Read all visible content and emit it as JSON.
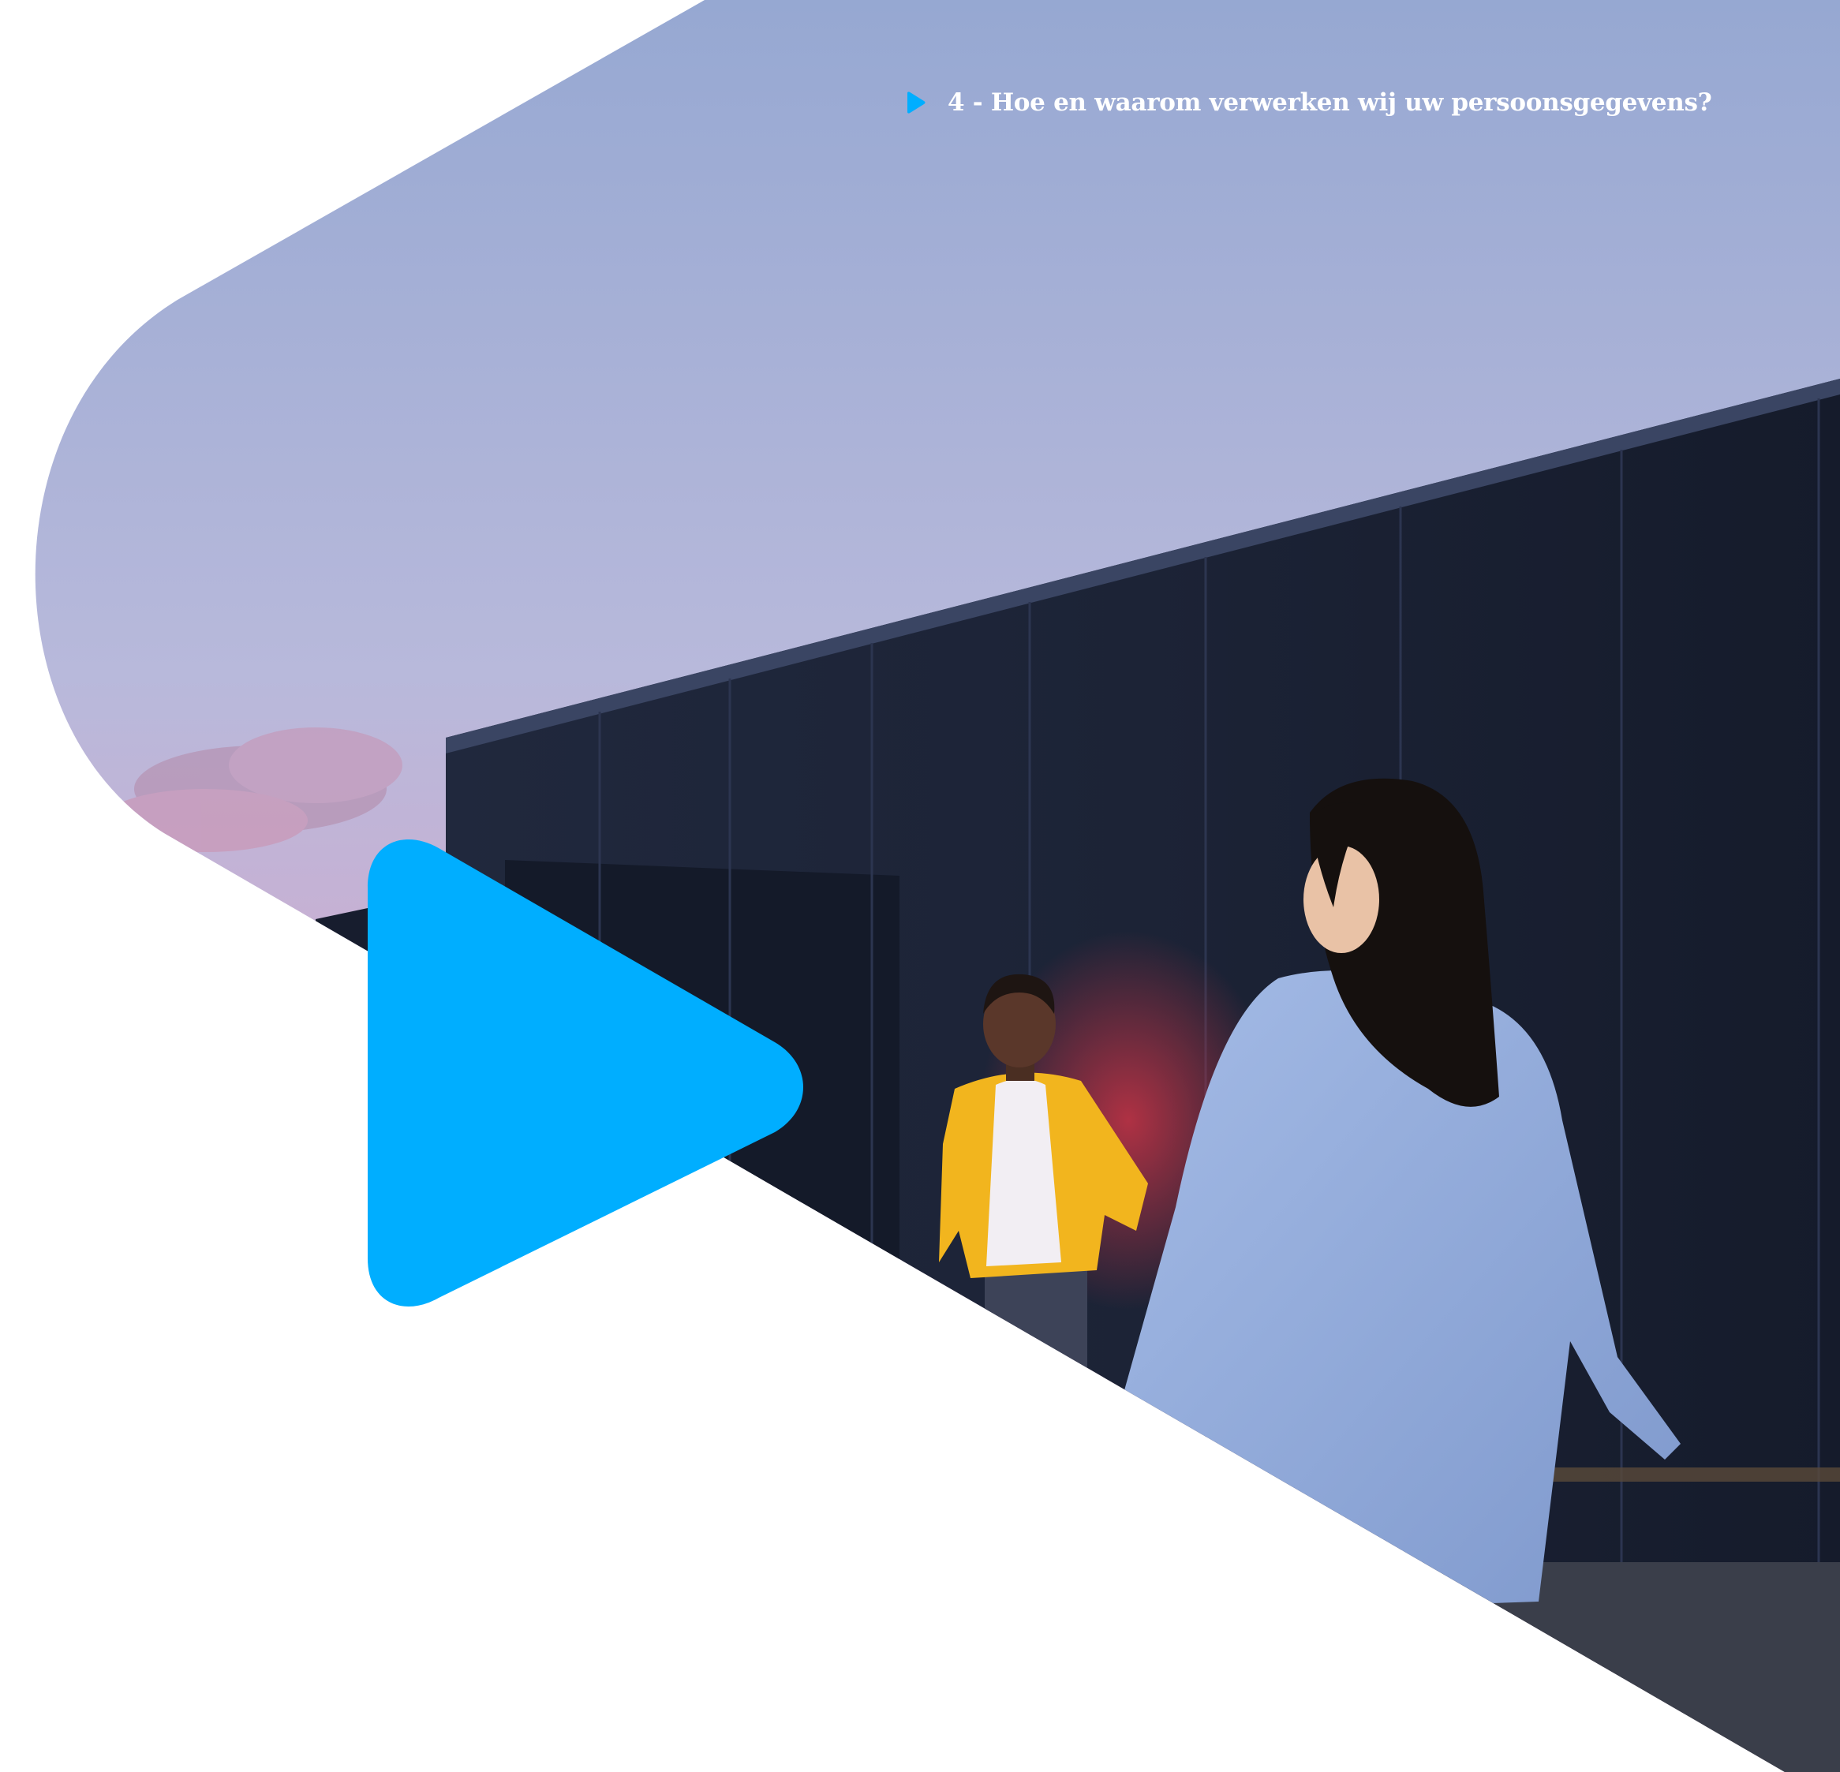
{
  "page": {
    "section_heading": "4 - Hoe en waarom verwerken wij uw persoonsgegevens?"
  },
  "icons": {
    "heading_marker": "play-triangle-icon",
    "large_decoration": "play-triangle-icon"
  },
  "colors": {
    "accent": "#00AEFF",
    "heading_text": "#ffffff",
    "page_background": "#ffffff",
    "sky_top": "#98A9D3",
    "sky_bottom": "#D4A8C8",
    "wall": "#1B2236",
    "jacket_yellow": "#F2B51E",
    "coat_blue": "#92ADDD"
  },
  "photo": {
    "subject": "two people walking on a rooftop at dusk beside a dark paneled wall"
  }
}
